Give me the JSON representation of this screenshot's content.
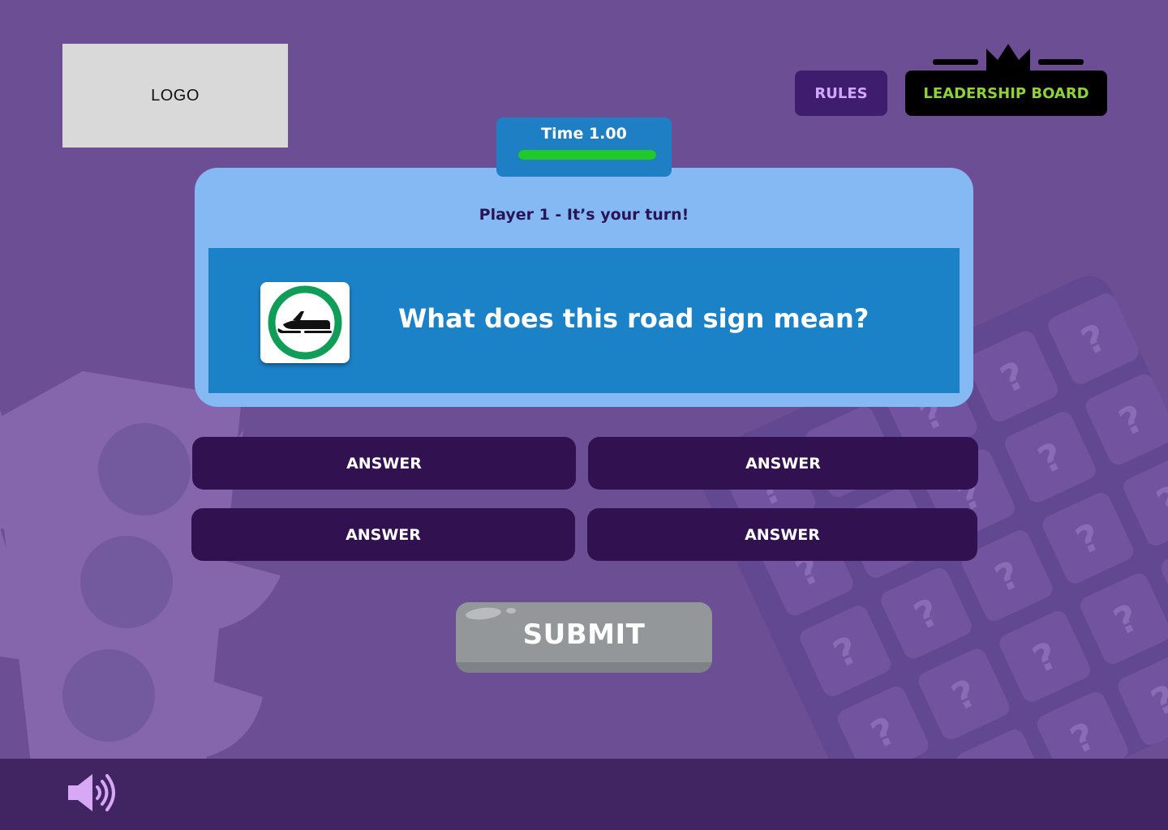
{
  "header": {
    "logo_text": "LOGO",
    "rules_label": "RULES",
    "leaderboard_label": "LEADERSHIP BOARD"
  },
  "timer": {
    "label": "Time 1.00",
    "progress": 1.0
  },
  "question": {
    "turn_text": "Player 1 - It’s your turn!",
    "text": "What does this road sign mean?",
    "sign_icon": "snowmobile-sign-icon"
  },
  "answers": [
    {
      "label": "ANSWER"
    },
    {
      "label": "ANSWER"
    },
    {
      "label": "ANSWER"
    },
    {
      "label": "ANSWER"
    }
  ],
  "submit": {
    "label": "SUBMIT"
  },
  "footer": {
    "sound_icon": "speaker-volume-icon"
  },
  "colors": {
    "background": "#6b4e93",
    "card": "#85b9f3",
    "question_panel": "#1b82c8",
    "answer_button": "#311150",
    "timer_fill": "#20c82a",
    "leaderboard_text": "#8fd13a",
    "rules_text": "#d2a7ff",
    "sign_ring": "#0f9d58"
  }
}
